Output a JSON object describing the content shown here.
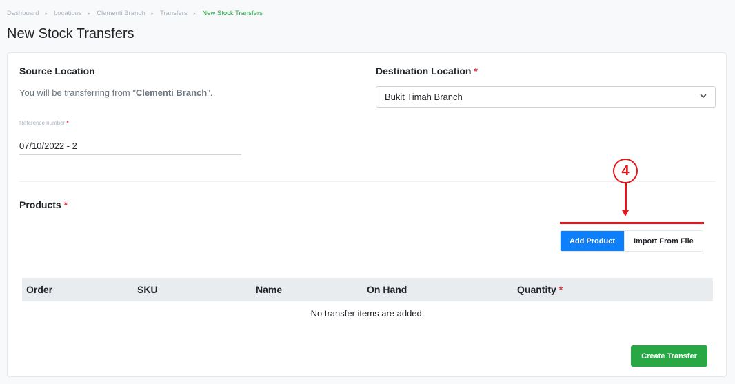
{
  "breadcrumb": [
    "Dashboard",
    "Locations",
    "Clementi Branch",
    "Transfers",
    "New Stock Transfers"
  ],
  "breadcrumb_separator": "▸",
  "page_title": "New Stock Transfers",
  "source": {
    "label": "Source Location",
    "desc_prefix": "You will be transferring from \"",
    "desc_branch": "Clementi Branch",
    "desc_suffix": "\"."
  },
  "destination": {
    "label": "Destination Location",
    "required_mark": "*",
    "selected": "Bukit Timah Branch",
    "chevron_icon": "chevron-down-icon"
  },
  "reference": {
    "label": "Reference number",
    "required_mark": "*",
    "value": "07/10/2022 - 2"
  },
  "products": {
    "label": "Products",
    "required_mark": "*",
    "add_button": "Add Product",
    "import_button": "Import From File"
  },
  "annotation": {
    "step_number": "4",
    "color": "#e8141a"
  },
  "table": {
    "columns": [
      "Order",
      "SKU",
      "Name",
      "On Hand",
      "Quantity"
    ],
    "quantity_required_mark": "*",
    "empty_message": "No transfer items are added."
  },
  "create_button": "Create Transfer",
  "colors": {
    "primary": "#0d7ffb",
    "success": "#28a745",
    "danger": "#dc3545"
  }
}
